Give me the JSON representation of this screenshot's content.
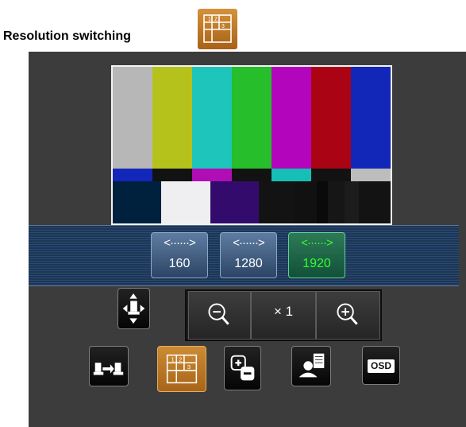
{
  "heading": {
    "title": "Resolution switching",
    "icon": "resolution-switch-icon"
  },
  "color_bars": {
    "top": [
      "#b7b7b7",
      "#b5c21b",
      "#1ec5bb",
      "#26be2a",
      "#b305bb",
      "#aa0414",
      "#1227b7"
    ],
    "middle": [
      "#1226b9",
      "#121212",
      "#b00db5",
      "#121212",
      "#15bfb5",
      "#121212",
      "#bdbdbd"
    ],
    "bottom": [
      "#00213e",
      "#efeff2",
      "#330b6c",
      "#131313",
      "#111111",
      "#0a0a0a",
      "#161616",
      "#1c1c1c",
      "#131313"
    ]
  },
  "resolution": {
    "buttons": [
      {
        "label": "160",
        "arrow": "<······>",
        "active": false
      },
      {
        "label": "1280",
        "arrow": "<······>",
        "active": false
      },
      {
        "label": "1920",
        "arrow": "<······>",
        "active": true
      }
    ],
    "active_color": "#33ff33"
  },
  "zoom": {
    "level": "× 1"
  },
  "toolbar": {
    "osd_label": "OSD",
    "icons": [
      "pan-tilt-icon",
      "zoom-out-icon",
      "zoom-in-icon",
      "preset-icon",
      "resolution-switch-icon",
      "brightness-icon",
      "camera-control-icon",
      "osd-button"
    ]
  },
  "colors": {
    "panel": "#3c3c3c",
    "accent": "#c8862c"
  }
}
